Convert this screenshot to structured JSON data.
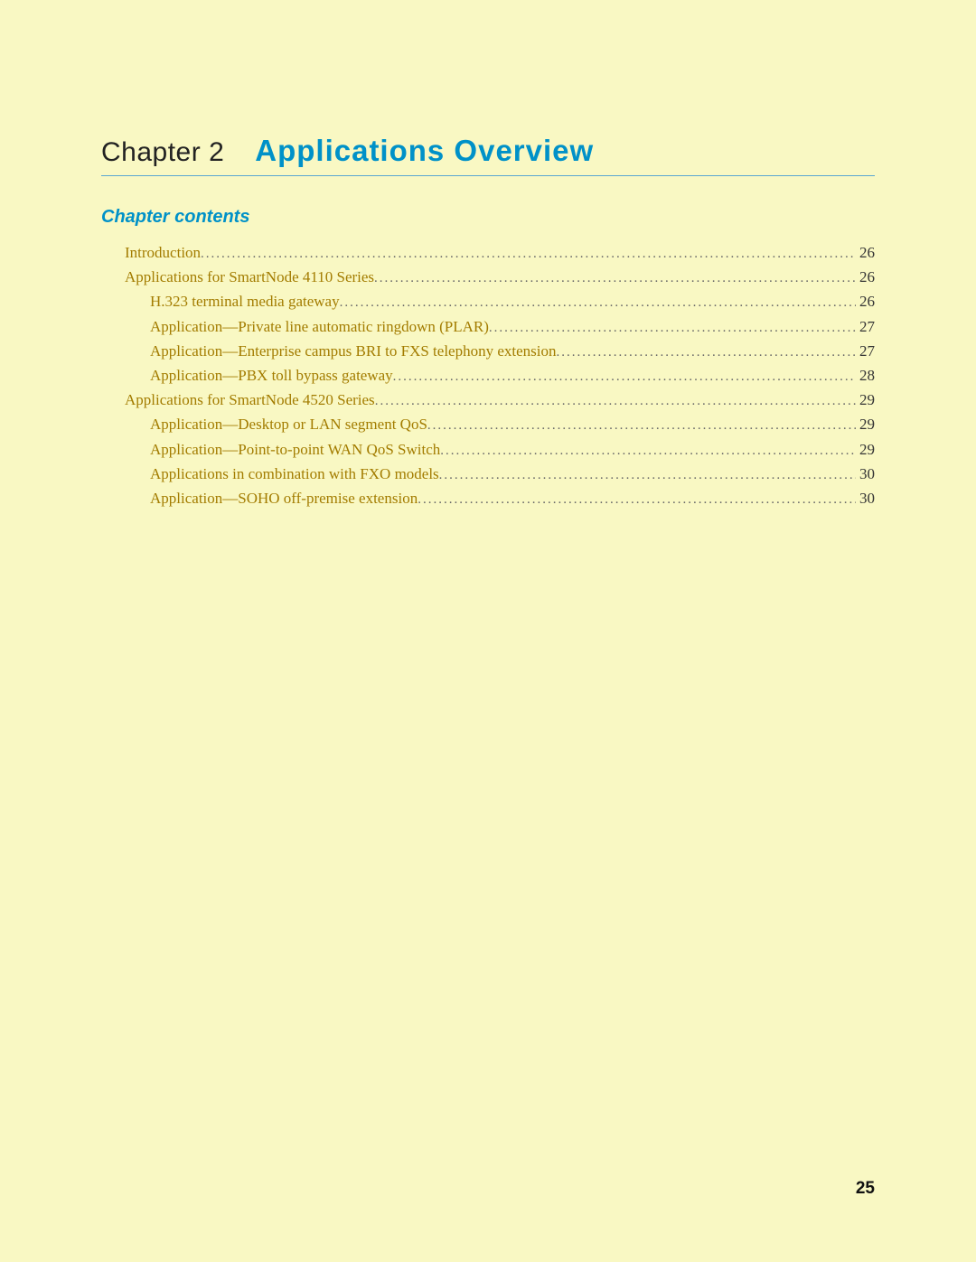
{
  "chapter": {
    "label": "Chapter 2",
    "title": "Applications Overview"
  },
  "contents_heading": "Chapter contents",
  "toc": [
    {
      "text": "Introduction",
      "page": "26",
      "indent": 1
    },
    {
      "text": "Applications for SmartNode 4110 Series ",
      "page": "26",
      "indent": 1
    },
    {
      "text": "H.323 terminal media gateway ",
      "page": "26",
      "indent": 2
    },
    {
      "text": "Application—Private line automatic ringdown (PLAR) ",
      "page": "27",
      "indent": 2
    },
    {
      "text": "Application—Enterprise campus BRI to FXS telephony extension ",
      "page": "27",
      "indent": 2
    },
    {
      "text": "Application—PBX toll bypass gateway ",
      "page": "28",
      "indent": 2
    },
    {
      "text": "Applications for SmartNode 4520 Series ",
      "page": "29",
      "indent": 1
    },
    {
      "text": "Application—Desktop or LAN segment QoS ",
      "page": "29",
      "indent": 2
    },
    {
      "text": "Application—Point-to-point WAN QoS Switch ",
      "page": "29",
      "indent": 2
    },
    {
      "text": "Applications in combination with FXO models ",
      "page": "30",
      "indent": 2
    },
    {
      "text": "Application—SOHO off-premise extension ",
      "page": "30",
      "indent": 2
    }
  ],
  "page_number": "25"
}
